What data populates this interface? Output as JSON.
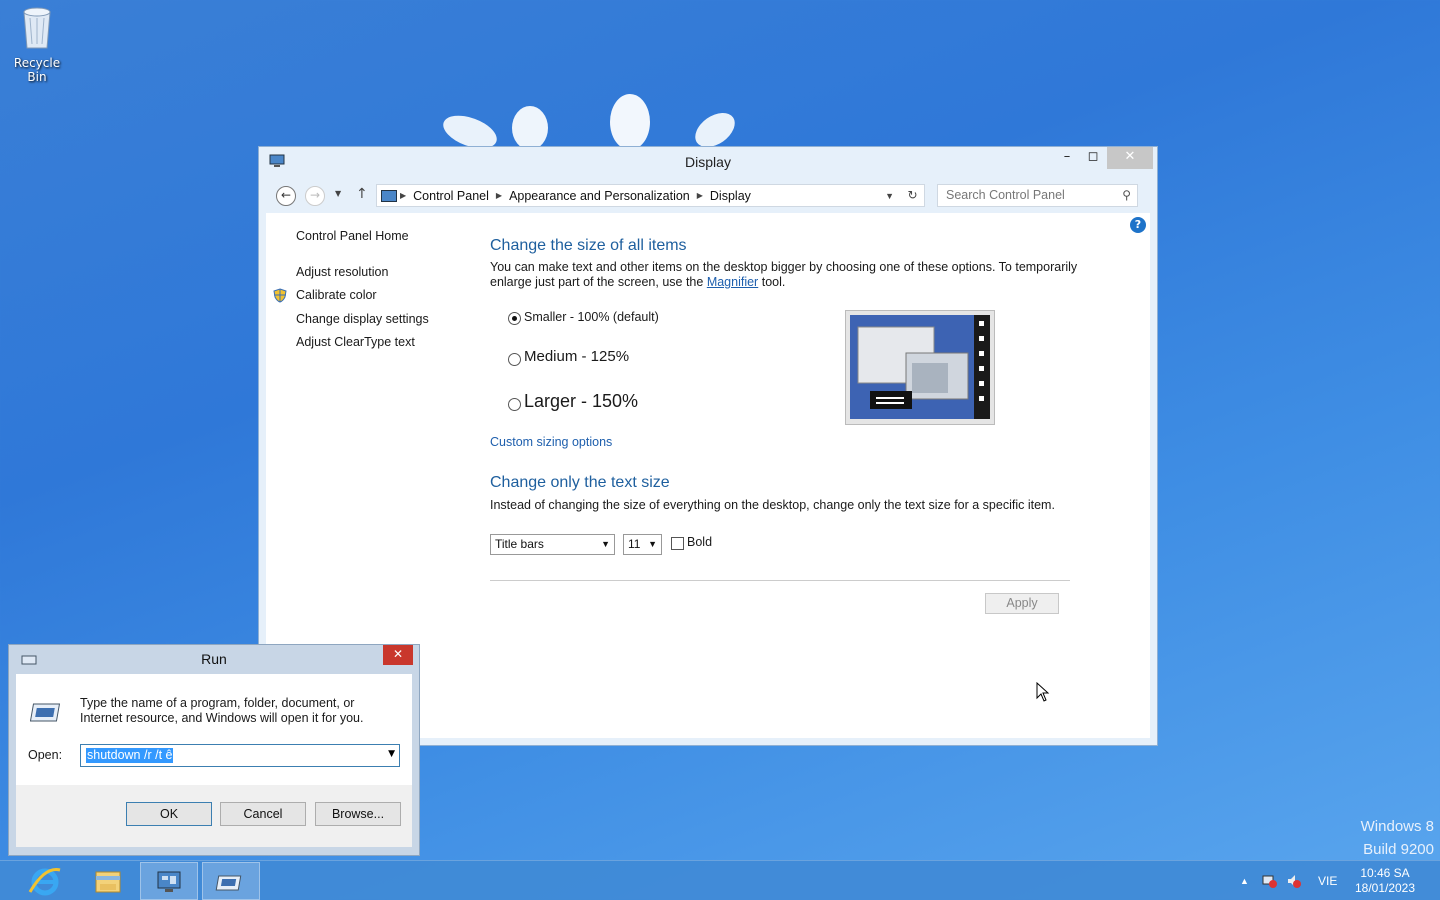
{
  "desktop": {
    "recycle_bin_label": "Recycle Bin",
    "watermark_line1": "Windows 8",
    "watermark_line2": "Build 9200"
  },
  "display_window": {
    "title": "Display",
    "breadcrumb": [
      "Control Panel",
      "Appearance and Personalization",
      "Display"
    ],
    "search_placeholder": "Search Control Panel",
    "sidebar": {
      "home": "Control Panel Home",
      "links": [
        "Adjust resolution",
        "Calibrate color",
        "Change display settings",
        "Adjust ClearType text"
      ]
    },
    "section1": {
      "heading": "Change the size of all items",
      "desc_part1": "You can make text and other items on the desktop bigger by choosing one of these options. To temporarily",
      "desc_part2": "enlarge just part of the screen, use the",
      "magnifier_link": "Magnifier",
      "desc_part3": "tool.",
      "options": [
        {
          "label": "Smaller - 100% (default)",
          "selected": true
        },
        {
          "label": "Medium - 125%",
          "selected": false
        },
        {
          "label": "Larger - 150%",
          "selected": false
        }
      ],
      "custom_link": "Custom sizing options"
    },
    "section2": {
      "heading": "Change only the text size",
      "desc": "Instead of changing the size of everything on the desktop, change only the text size for a specific item.",
      "item_select": "Title bars",
      "size_select": "11",
      "bold_label": "Bold",
      "bold_checked": false
    },
    "apply_label": "Apply"
  },
  "run_dialog": {
    "title": "Run",
    "description": "Type the name of a program, folder, document, or Internet resource, and Windows will open it for you.",
    "open_label": "Open:",
    "open_value": "shutdown /r /t ê",
    "ok_label": "OK",
    "cancel_label": "Cancel",
    "browse_label": "Browse..."
  },
  "taskbar": {
    "language": "VIE",
    "time": "10:46 SA",
    "date": "18/01/2023"
  },
  "colors": {
    "accent_blue": "#1e5f9e",
    "taskbar": "#408ad6",
    "close_red": "#c9372c"
  }
}
